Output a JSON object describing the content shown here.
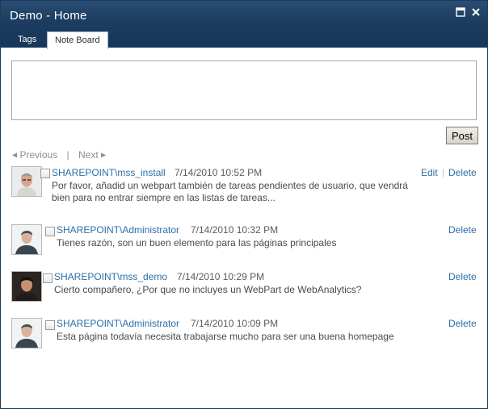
{
  "window": {
    "title": "Demo - Home",
    "maximize_icon": "maximize-icon",
    "close_icon": "close-icon"
  },
  "tabs": [
    {
      "label": "Tags",
      "active": false
    },
    {
      "label": "Note Board",
      "active": true
    }
  ],
  "note_input": {
    "value": "",
    "placeholder": ""
  },
  "post_button": {
    "label": "Post"
  },
  "pager": {
    "previous": "Previous",
    "separator": "|",
    "next": "Next"
  },
  "notes": [
    {
      "author": "SHAREPOINT\\mss_install",
      "date": "7/14/2010 10:52 PM",
      "text_line1": "Por favor, añadid un webpart también de tareas pendientes de usuario, que vendrá",
      "text_line2": "bien para no entrar siempre en las listas de tareas...",
      "edit": "Edit",
      "delete": "Delete",
      "avatar": "avatar-older-man-icon"
    },
    {
      "author": "SHAREPOINT\\Administrator",
      "date": "7/14/2010 10:32 PM",
      "text": "Tienes razón, son un buen elemento para las páginas principales",
      "delete": "Delete",
      "avatar": "avatar-administrator-icon"
    },
    {
      "author": "SHAREPOINT\\mss_demo",
      "date": "7/14/2010 10:29 PM",
      "text": "Cierto compañero, ¿Por que no incluyes un WebPart de WebAnalytics?",
      "delete": "Delete",
      "avatar": "avatar-dark-hair-icon"
    },
    {
      "author": "SHAREPOINT\\Administrator",
      "date": "7/14/2010 10:09 PM",
      "text": "Esta página todavía necesita trabajarse mucho para ser una buena homepage",
      "delete": "Delete",
      "avatar": "avatar-administrator-icon"
    }
  ],
  "colors": {
    "titlebar": "#1c3c60",
    "link": "#2c6fa8",
    "text": "#4a4a4a"
  }
}
